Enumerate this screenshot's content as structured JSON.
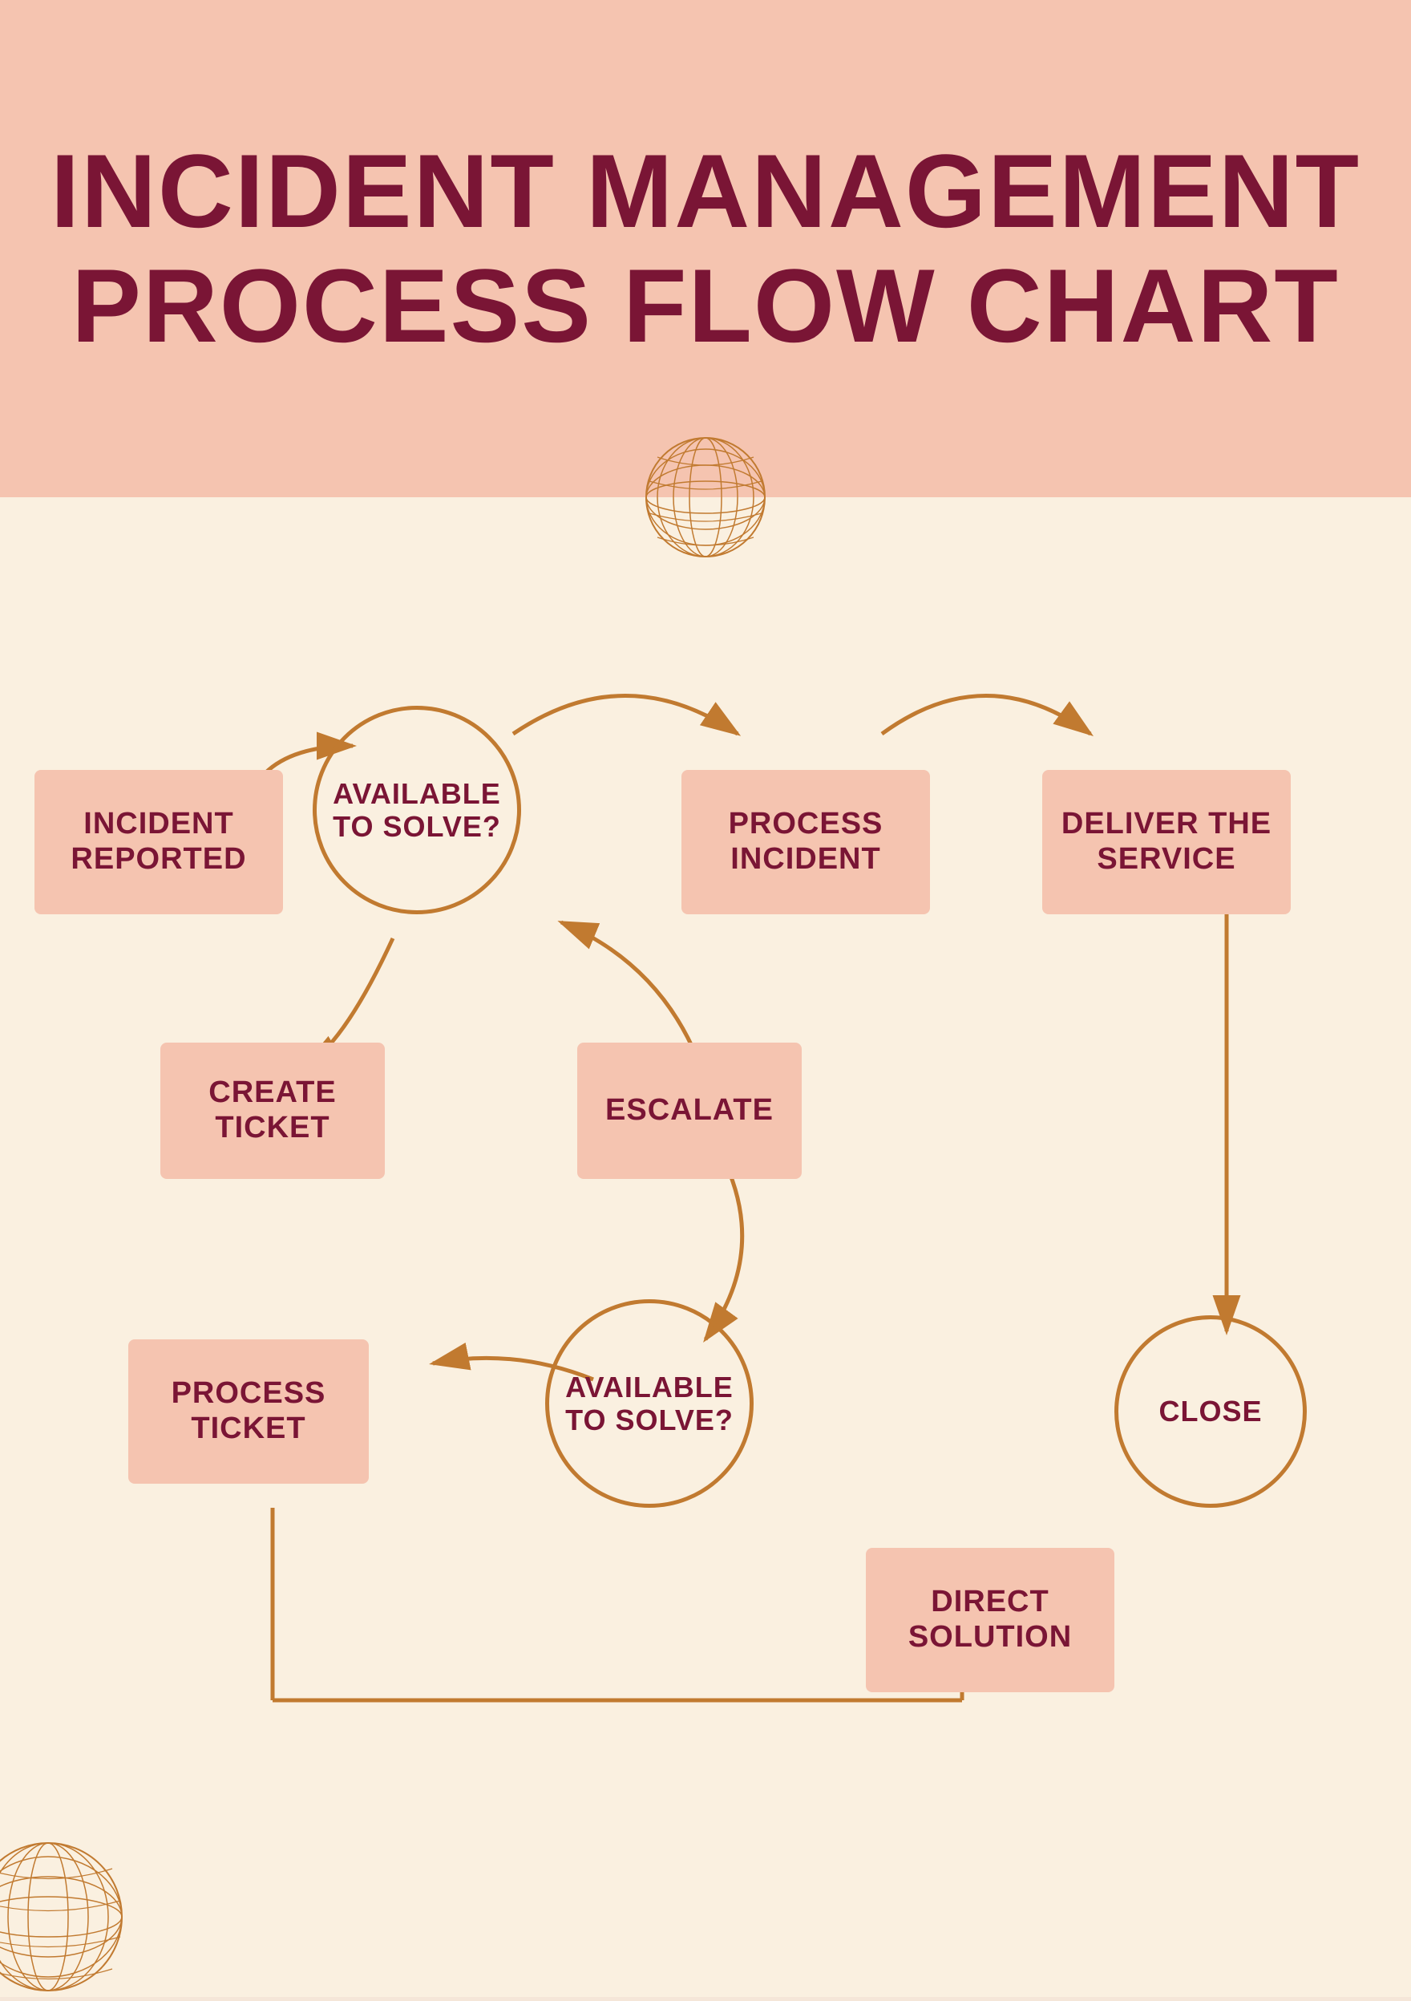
{
  "header": {
    "title": "INCIDENT MANAGEMENT PROCESS FLOW CHART"
  },
  "flowchart": {
    "nodes": [
      {
        "id": "incident-reported",
        "label": "INCIDENT\nREPORTED",
        "type": "rect"
      },
      {
        "id": "available-to-solve-1",
        "label": "AVAILABLE\nTO SOLVE?",
        "type": "circle"
      },
      {
        "id": "process-incident",
        "label": "PROCESS\nINCIDENT",
        "type": "rect"
      },
      {
        "id": "deliver-the-service",
        "label": "DELIVER THE\nSERVICE",
        "type": "rect"
      },
      {
        "id": "create-ticket",
        "label": "CREATE\nTICKET",
        "type": "rect"
      },
      {
        "id": "escalate",
        "label": "ESCALATE",
        "type": "rect"
      },
      {
        "id": "close",
        "label": "CLOSE",
        "type": "circle"
      },
      {
        "id": "process-ticket",
        "label": "PROCESS\nTICKET",
        "type": "rect"
      },
      {
        "id": "available-to-solve-2",
        "label": "AVAILABLE\nTO SOLVE?",
        "type": "circle"
      },
      {
        "id": "direct-solution",
        "label": "DIRECT\nSOLUTION",
        "type": "rect"
      }
    ]
  }
}
